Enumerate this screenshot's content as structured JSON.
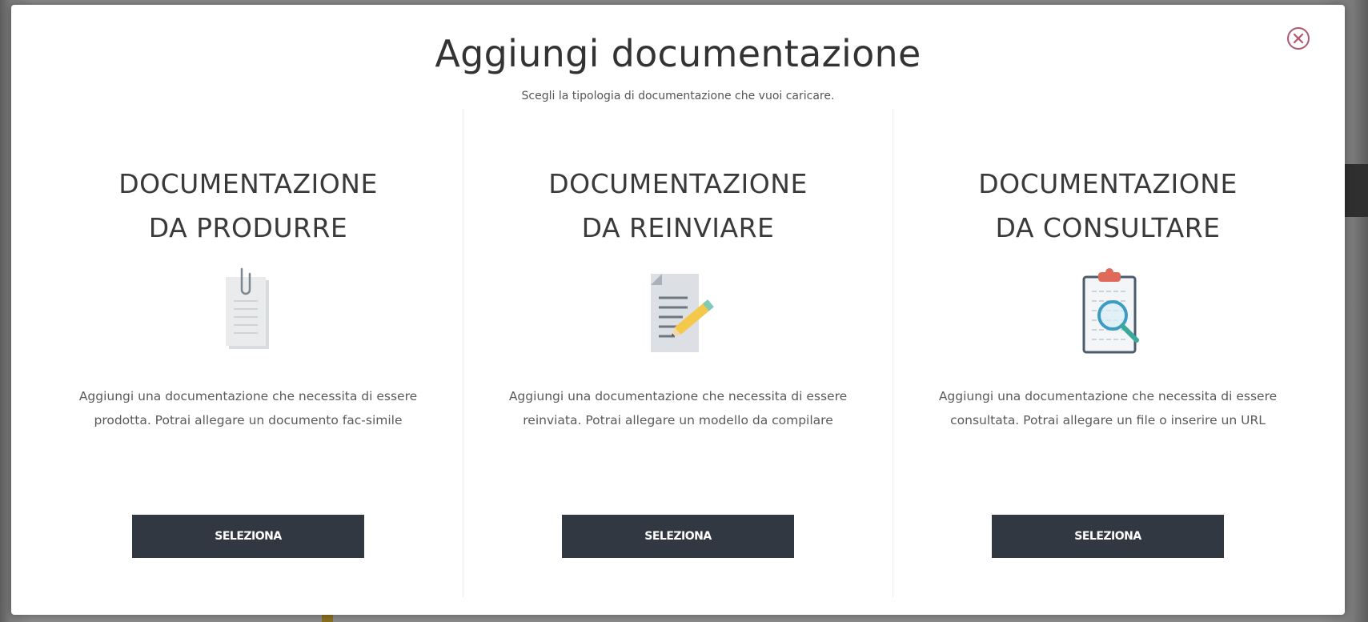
{
  "modal": {
    "title": "Aggiungi documentazione",
    "subtitle": "Scegli la tipologia di documentazione che vuoi caricare.",
    "close_icon": "close-circle-icon"
  },
  "options": [
    {
      "title_line1": "DOCUMENTAZIONE",
      "title_line2": "DA PRODURRE",
      "icon": "paperclip-document-icon",
      "description": "Aggiungi una documentazione che necessita di essere prodotta. Potrai allegare un documento fac-simile",
      "button_label": "SELEZIONA"
    },
    {
      "title_line1": "DOCUMENTAZIONE",
      "title_line2": "DA REINVIARE",
      "icon": "document-pencil-icon",
      "description": "Aggiungi una documentazione che necessita di essere reinviata. Potrai allegare un modello da compilare",
      "button_label": "SELEZIONA"
    },
    {
      "title_line1": "DOCUMENTAZIONE",
      "title_line2": "DA CONSULTARE",
      "icon": "clipboard-search-icon",
      "description": "Aggiungi una documentazione che necessita di essere consultata. Potrai allegare un file o inserire un URL",
      "button_label": "SELEZIONA"
    }
  ],
  "colors": {
    "button_bg": "#323841",
    "close_accent": "#b0566f",
    "title_text": "#333333"
  }
}
